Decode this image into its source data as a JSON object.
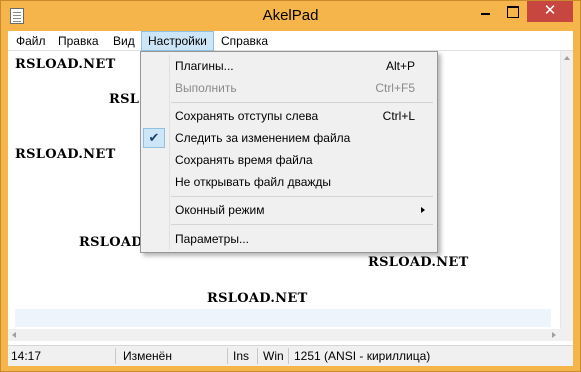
{
  "window": {
    "title": "AkelPad",
    "close_glyph": "✕"
  },
  "menubar": {
    "items": [
      {
        "label": "Файл"
      },
      {
        "label": "Правка"
      },
      {
        "label": "Вид"
      },
      {
        "label": "Настройки"
      },
      {
        "label": "Справка"
      }
    ],
    "active_index": 3
  },
  "editor": {
    "lines": [
      "RSLOAD.NET",
      "RSL",
      "RSLOAD.NET",
      "RSLOAD",
      "RSLOAD.NET",
      "RSLOAD.NET"
    ]
  },
  "settings_menu": {
    "items": [
      {
        "label": "Плагины...",
        "shortcut": "Alt+P",
        "enabled": true
      },
      {
        "label": "Выполнить",
        "shortcut": "Ctrl+F5",
        "enabled": false
      },
      {
        "label": "Сохранять отступы слева",
        "shortcut": "Ctrl+L",
        "enabled": true
      },
      {
        "label": "Следить за изменением файла",
        "checked": true,
        "check_glyph": "✔",
        "enabled": true
      },
      {
        "label": "Сохранять время файла",
        "enabled": true
      },
      {
        "label": "Не открывать файл дважды",
        "enabled": true
      },
      {
        "label": "Оконный режим",
        "has_submenu": true,
        "enabled": true
      },
      {
        "label": "Параметры...",
        "enabled": true
      }
    ]
  },
  "statusbar": {
    "position": "14:17",
    "modified": "Изменён",
    "insert_mode": "Ins",
    "newline": "Win",
    "encoding": "1251  (ANSI - кириллица)"
  },
  "colors": {
    "titlebar": "#f6b54a",
    "close_button": "#c7463f",
    "menu_highlight": "#cde6f7",
    "current_line": "#eef4fb"
  }
}
